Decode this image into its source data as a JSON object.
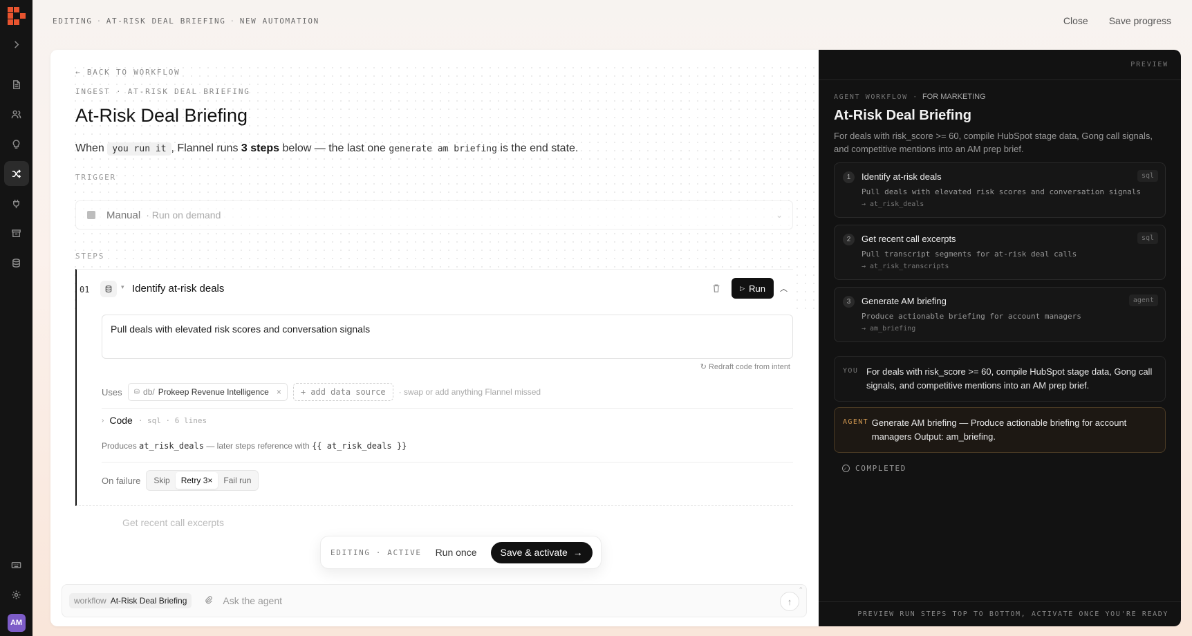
{
  "header": {
    "breadcrumb": [
      "EDITING",
      "AT-RISK DEAL BRIEFING",
      "NEW AUTOMATION"
    ],
    "close_label": "Close",
    "save_progress_label": "Save progress"
  },
  "rail": {
    "user_initials": "AM",
    "icons": [
      "logo",
      "expand-chevron-icon",
      "document-icon",
      "users-icon",
      "lightbulb-icon",
      "workflow-icon",
      "plug-icon",
      "archive-icon",
      "database-icon",
      "keyboard-icon",
      "gear-icon"
    ]
  },
  "editor": {
    "back_label": "← BACK TO WORKFLOW",
    "crumb": "INGEST · AT-RISK DEAL BRIEFING",
    "title": "At-Risk Deal Briefing",
    "sentence": {
      "when": "When",
      "trigger_chip": "you run it",
      "mid": ", Flannel runs",
      "steps_count": "3 steps",
      "mid2": "below — the last one",
      "end_chip": "generate am briefing",
      "tail": "is the end state."
    },
    "trigger_label": "TRIGGER",
    "trigger": {
      "name": "Manual",
      "sub": "· Run on demand"
    },
    "steps_label": "STEPS",
    "step": {
      "number": "01",
      "title": "Identify at-risk deals",
      "run_label": "Run",
      "intent": "Pull deals with elevated risk scores and conversation signals",
      "redraft_label": "Redraft code from intent",
      "uses_label": "Uses",
      "datasource_prefix": "db/",
      "datasource_name": "Prokeep Revenue Intelligence",
      "add_source_label": "+ add data source",
      "uses_hint": "· swap or add anything Flannel missed",
      "code_label": "Code",
      "code_meta": "· sql · 6 lines",
      "produces_prefix": "Produces",
      "produces_var": "at_risk_deals",
      "produces_mid": "— later steps reference with",
      "produces_ref": "{{ at_risk_deals }}",
      "failure_label": "On failure",
      "failure_options": [
        "Skip",
        "Retry 3×",
        "Fail run"
      ],
      "failure_selected": "Retry 3×"
    },
    "next_step_title": "Get recent call excerpts"
  },
  "action_bar": {
    "status": "EDITING · ACTIVE",
    "run_once_label": "Run once",
    "save_label": "Save & activate"
  },
  "chat": {
    "chip_key": "workflow",
    "chip_value": "At-Risk Deal Briefing",
    "placeholder": "Ask the agent"
  },
  "preview": {
    "header": "PREVIEW",
    "crumb_key": "AGENT WORKFLOW ·",
    "crumb_value": "FOR MARKETING",
    "title": "At-Risk Deal Briefing",
    "description": "For deals with risk_score >= 60, compile HubSpot stage data, Gong call signals, and competitive mentions into an AM prep brief.",
    "steps": [
      {
        "n": "1",
        "title": "Identify at-risk deals",
        "tag": "sql",
        "desc": "Pull deals with elevated risk scores and conversation signals",
        "out": "→ at_risk_deals"
      },
      {
        "n": "2",
        "title": "Get recent call excerpts",
        "tag": "sql",
        "desc": "Pull transcript segments for at-risk deal calls",
        "out": "→ at_risk_transcripts"
      },
      {
        "n": "3",
        "title": "Generate AM briefing",
        "tag": "agent",
        "desc": "Produce actionable briefing for account managers",
        "out": "→ am_briefing"
      }
    ],
    "messages": [
      {
        "who": "YOU",
        "text": "For deals with risk_score >= 60, compile HubSpot stage data, Gong call signals, and competitive mentions into an AM prep brief."
      },
      {
        "who": "AGENT",
        "text": "Generate AM briefing — Produce actionable briefing for account managers Output: am_briefing."
      }
    ],
    "status": "COMPLETED",
    "footer": "PREVIEW RUN STEPS TOP TO BOTTOM, ACTIVATE ONCE YOU'RE READY"
  }
}
